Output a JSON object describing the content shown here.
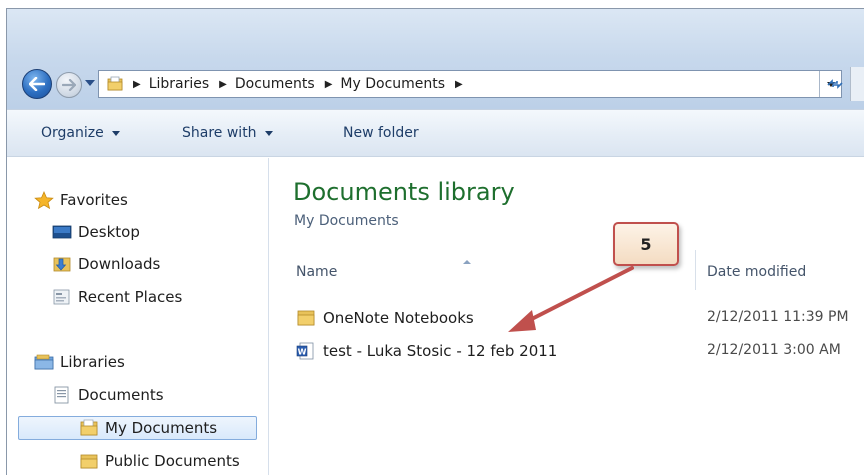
{
  "address_bar": {
    "breadcrumbs": [
      "Libraries",
      "Documents",
      "My Documents"
    ]
  },
  "toolbar": {
    "organize_label": "Organize",
    "share_with_label": "Share with",
    "new_folder_label": "New folder"
  },
  "navigation": {
    "favorites_label": "Favorites",
    "desktop_label": "Desktop",
    "downloads_label": "Downloads",
    "recent_places_label": "Recent Places",
    "libraries_label": "Libraries",
    "documents_label": "Documents",
    "my_documents_label": "My Documents",
    "public_documents_label": "Public Documents"
  },
  "content": {
    "title": "Documents library",
    "subtitle": "My Documents",
    "columns": {
      "name": "Name",
      "date_modified": "Date modified"
    },
    "files": [
      {
        "name": "OneNote Notebooks",
        "date": "2/12/2011 11:39 PM",
        "icon": "folder-icon"
      },
      {
        "name": "test - Luka Stosic - 12 feb 2011",
        "date": "2/12/2011 3:00 AM",
        "icon": "word-document-icon"
      }
    ]
  },
  "callout": {
    "number": "5",
    "color": "#c0504d"
  },
  "colors": {
    "library_title": "#1e6f2e",
    "toolbar_text": "#1e3d68",
    "selection_border": "#84acdd"
  }
}
